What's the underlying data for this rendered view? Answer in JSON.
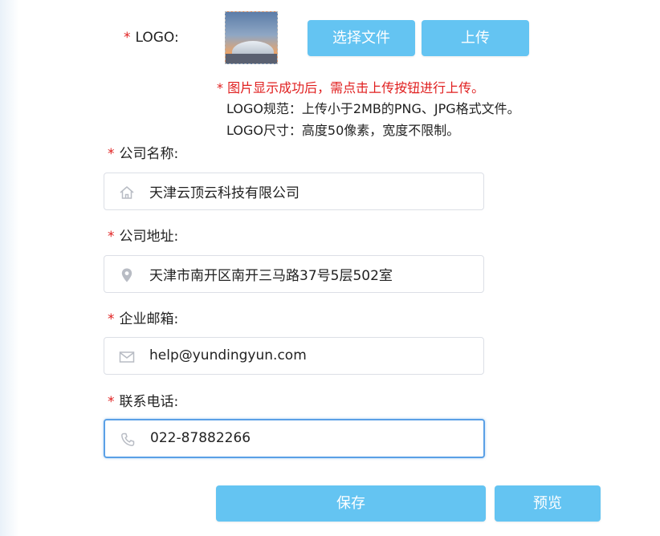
{
  "logo": {
    "required_mark": "*",
    "label": "LOGO:",
    "choose_file_label": "选择文件",
    "upload_label": "上传",
    "notice": "* 图片显示成功后，需点击上传按钮进行上传。",
    "spec_format": "LOGO规范：上传小于2MB的PNG、JPG格式文件。",
    "spec_size": "LOGO尺寸：高度50像素，宽度不限制。"
  },
  "form": {
    "company_name": {
      "required_mark": "*",
      "label": "公司名称:",
      "value": "天津云顶云科技有限公司",
      "icon": "home-icon"
    },
    "company_address": {
      "required_mark": "*",
      "label": "公司地址:",
      "value": "天津市南开区南开三马路37号5层502室",
      "icon": "location-pin-icon"
    },
    "company_email": {
      "required_mark": "*",
      "label": "企业邮箱:",
      "value": "help@yundingyun.com",
      "icon": "mail-icon"
    },
    "contact_phone": {
      "required_mark": "*",
      "label": "联系电话:",
      "value": "022-87882266",
      "icon": "phone-icon",
      "focused": true
    }
  },
  "actions": {
    "save_label": "保存",
    "preview_label": "预览"
  },
  "colors": {
    "button": "#64c4f2",
    "required": "#e01e1e",
    "focus_border": "#5aa0e6",
    "input_border": "#dcdfe6"
  }
}
